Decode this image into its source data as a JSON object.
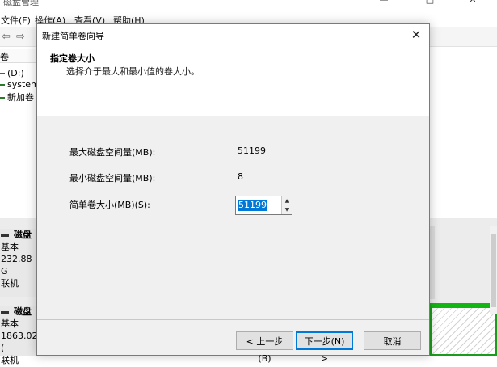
{
  "background_window": {
    "title": "磁盘管理",
    "controls": {
      "minimize": "—",
      "maximize": "□",
      "close": "✕"
    },
    "menu": [
      "文件(F)",
      "操作(A)",
      "查看(V)",
      "帮助(H)"
    ],
    "list_header": "卷",
    "volumes": [
      "(D:)",
      "system",
      "新加卷"
    ],
    "disks": [
      {
        "name": "磁盘",
        "type": "基本",
        "size": "232.88 G",
        "status": "联机"
      },
      {
        "name": "磁盘",
        "type": "基本",
        "size": "1863.02 (",
        "status": "联机"
      }
    ]
  },
  "dialog": {
    "title": "新建简单卷向导",
    "close_glyph": "✕",
    "heading": "指定卷大小",
    "subheading": "选择介于最大和最小值的卷大小。",
    "max_label": "最大磁盘空间量(MB):",
    "max_value": "51199",
    "min_label": "最小磁盘空间量(MB):",
    "min_value": "8",
    "size_label": "简单卷大小(MB)(S):",
    "size_value": "51199",
    "buttons": {
      "back": "< 上一步(B)",
      "next": "下一步(N) >",
      "cancel": "取消"
    }
  },
  "colors": {
    "selection": "#0078d7",
    "partition_green": "#13b513"
  },
  "icons": [
    "back-arrow-icon",
    "forward-arrow-icon",
    "close-icon",
    "spin-up-icon",
    "spin-down-icon",
    "disk-icon"
  ]
}
